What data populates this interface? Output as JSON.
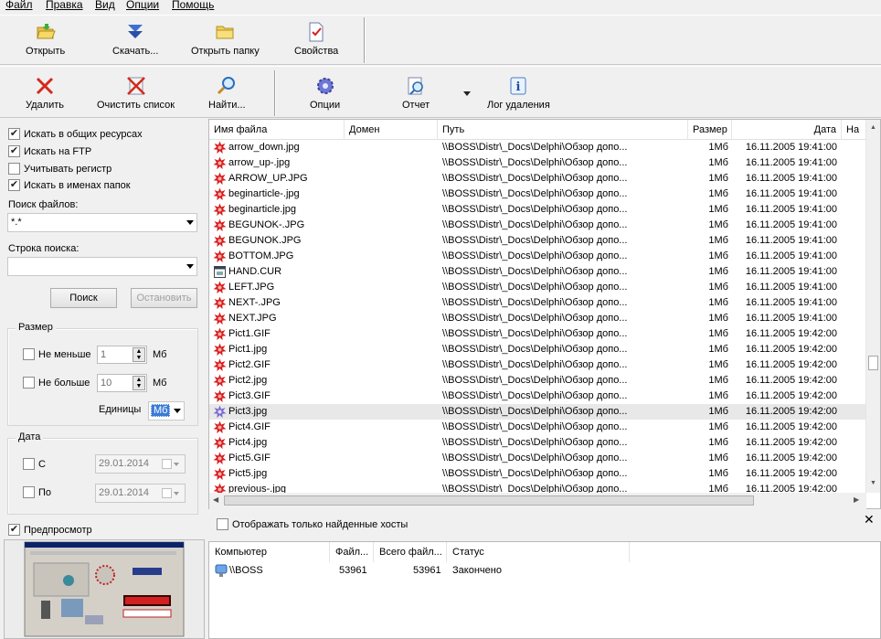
{
  "menu": [
    "Файл",
    "Правка",
    "Вид",
    "Опции",
    "Помощь"
  ],
  "toolbar1": {
    "open": "Открыть",
    "download": "Скачать...",
    "open_folder": "Открыть папку",
    "properties": "Свойства"
  },
  "toolbar2": {
    "delete": "Удалить",
    "clear_list": "Очистить список",
    "find": "Найти...",
    "options": "Опции",
    "report": "Отчет",
    "delete_log": "Лог удаления"
  },
  "search": {
    "opt_shared": "Искать в общих ресурсах",
    "opt_ftp": "Искать на FTP",
    "opt_case": "Учитывать регистр",
    "opt_folders": "Искать в именах папок",
    "files_label": "Поиск файлов:",
    "files_value": "*.*",
    "string_label": "Строка поиска:",
    "string_value": "",
    "search_btn": "Поиск",
    "stop_btn": "Остановить"
  },
  "size": {
    "title": "Размер",
    "min_label": "Не меньше",
    "min_value": "1",
    "min_unit": "Мб",
    "max_label": "Не больше",
    "max_value": "10",
    "max_unit": "Мб",
    "units_label": "Единицы",
    "units_value": "Мб"
  },
  "date": {
    "title": "Дата",
    "from_label": "С",
    "from_value": "29.01.2014",
    "to_label": "По",
    "to_value": "29.01.2014"
  },
  "preview": {
    "label": "Предпросмотр"
  },
  "columns": {
    "name": "Имя файла",
    "domain": "Домен",
    "path": "Путь",
    "size": "Размер",
    "date": "Дата",
    "extra": "На"
  },
  "files": [
    {
      "name": "arrow_down.jpg",
      "path": "\\\\BOSS\\Distr\\_Docs\\Delphi\\Обзор допо...",
      "size": "1Мб",
      "date": "16.11.2005 19:41:00"
    },
    {
      "name": "arrow_up-.jpg",
      "path": "\\\\BOSS\\Distr\\_Docs\\Delphi\\Обзор допо...",
      "size": "1Мб",
      "date": "16.11.2005 19:41:00"
    },
    {
      "name": "ARROW_UP.JPG",
      "path": "\\\\BOSS\\Distr\\_Docs\\Delphi\\Обзор допо...",
      "size": "1Мб",
      "date": "16.11.2005 19:41:00"
    },
    {
      "name": "beginarticle-.jpg",
      "path": "\\\\BOSS\\Distr\\_Docs\\Delphi\\Обзор допо...",
      "size": "1Мб",
      "date": "16.11.2005 19:41:00"
    },
    {
      "name": "beginarticle.jpg",
      "path": "\\\\BOSS\\Distr\\_Docs\\Delphi\\Обзор допо...",
      "size": "1Мб",
      "date": "16.11.2005 19:41:00"
    },
    {
      "name": "BEGUNOK-.JPG",
      "path": "\\\\BOSS\\Distr\\_Docs\\Delphi\\Обзор допо...",
      "size": "1Мб",
      "date": "16.11.2005 19:41:00"
    },
    {
      "name": "BEGUNOK.JPG",
      "path": "\\\\BOSS\\Distr\\_Docs\\Delphi\\Обзор допо...",
      "size": "1Мб",
      "date": "16.11.2005 19:41:00"
    },
    {
      "name": "BOTTOM.JPG",
      "path": "\\\\BOSS\\Distr\\_Docs\\Delphi\\Обзор допо...",
      "size": "1Мб",
      "date": "16.11.2005 19:41:00"
    },
    {
      "name": "HAND.CUR",
      "path": "\\\\BOSS\\Distr\\_Docs\\Delphi\\Обзор допо...",
      "size": "1Мб",
      "date": "16.11.2005 19:41:00"
    },
    {
      "name": "LEFT.JPG",
      "path": "\\\\BOSS\\Distr\\_Docs\\Delphi\\Обзор допо...",
      "size": "1Мб",
      "date": "16.11.2005 19:41:00"
    },
    {
      "name": "NEXT-.JPG",
      "path": "\\\\BOSS\\Distr\\_Docs\\Delphi\\Обзор допо...",
      "size": "1Мб",
      "date": "16.11.2005 19:41:00"
    },
    {
      "name": "NEXT.JPG",
      "path": "\\\\BOSS\\Distr\\_Docs\\Delphi\\Обзор допо...",
      "size": "1Мб",
      "date": "16.11.2005 19:41:00"
    },
    {
      "name": "Pict1.GIF",
      "path": "\\\\BOSS\\Distr\\_Docs\\Delphi\\Обзор допо...",
      "size": "1Мб",
      "date": "16.11.2005 19:42:00"
    },
    {
      "name": "Pict1.jpg",
      "path": "\\\\BOSS\\Distr\\_Docs\\Delphi\\Обзор допо...",
      "size": "1Мб",
      "date": "16.11.2005 19:42:00"
    },
    {
      "name": "Pict2.GIF",
      "path": "\\\\BOSS\\Distr\\_Docs\\Delphi\\Обзор допо...",
      "size": "1Мб",
      "date": "16.11.2005 19:42:00"
    },
    {
      "name": "Pict2.jpg",
      "path": "\\\\BOSS\\Distr\\_Docs\\Delphi\\Обзор допо...",
      "size": "1Мб",
      "date": "16.11.2005 19:42:00"
    },
    {
      "name": "Pict3.GIF",
      "path": "\\\\BOSS\\Distr\\_Docs\\Delphi\\Обзор допо...",
      "size": "1Мб",
      "date": "16.11.2005 19:42:00"
    },
    {
      "name": "Pict3.jpg",
      "path": "\\\\BOSS\\Distr\\_Docs\\Delphi\\Обзор допо...",
      "size": "1Мб",
      "date": "16.11.2005 19:42:00"
    },
    {
      "name": "Pict4.GIF",
      "path": "\\\\BOSS\\Distr\\_Docs\\Delphi\\Обзор допо...",
      "size": "1Мб",
      "date": "16.11.2005 19:42:00"
    },
    {
      "name": "Pict4.jpg",
      "path": "\\\\BOSS\\Distr\\_Docs\\Delphi\\Обзор допо...",
      "size": "1Мб",
      "date": "16.11.2005 19:42:00"
    },
    {
      "name": "Pict5.GIF",
      "path": "\\\\BOSS\\Distr\\_Docs\\Delphi\\Обзор допо...",
      "size": "1Мб",
      "date": "16.11.2005 19:42:00"
    },
    {
      "name": "Pict5.jpg",
      "path": "\\\\BOSS\\Distr\\_Docs\\Delphi\\Обзор допо...",
      "size": "1Мб",
      "date": "16.11.2005 19:42:00"
    },
    {
      "name": "previous-.jpg",
      "path": "\\\\BOSS\\Distr\\_Docs\\Delphi\\Обзор допо...",
      "size": "1Мб",
      "date": "16.11.2005 19:42:00"
    }
  ],
  "hosts": {
    "show_found_label": "Отображать только найденные хосты",
    "columns": {
      "computer": "Компьютер",
      "files": "Файл...",
      "total": "Всего файл...",
      "status": "Статус"
    },
    "rows": [
      {
        "computer": "\\\\BOSS",
        "files": "53961",
        "total": "53961",
        "status": "Закончено"
      }
    ]
  },
  "colors": {
    "accent": "#3399ff",
    "units_highlight": "#3a7bd5",
    "file_icon_red": "#d81e1e"
  }
}
